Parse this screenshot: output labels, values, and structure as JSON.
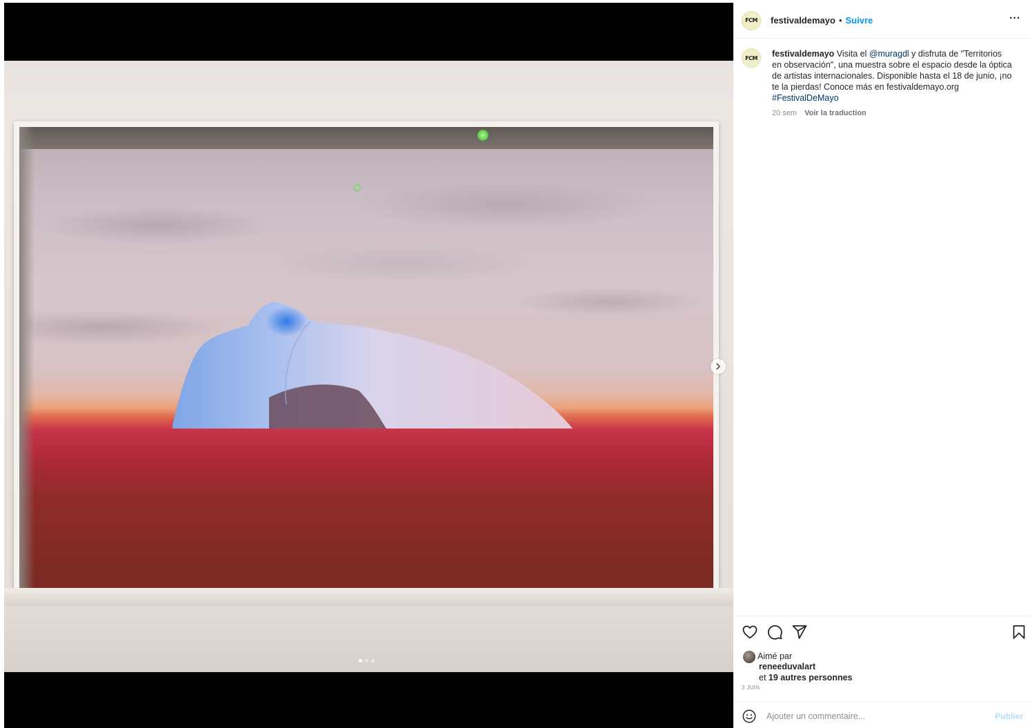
{
  "post": {
    "username": "festivaldemayo",
    "avatar_text": "FCM",
    "follow_label": "Suivre",
    "separator": "•",
    "more_label": "···"
  },
  "caption": {
    "username": "festivaldemayo",
    "text_before_mention": " Visita el ",
    "mention": "@muragdl",
    "text_after_mention": " y disfruta de \"Territorios en observación\", una muestra sobre el espacio desde la óptica de artistas internacionales. Disponible hasta el 18 de junio, ¡no te la pierdas! Conoce más en festivaldemayo.org",
    "hashtag": "#FestivalDeMayo",
    "age": "20 sem",
    "translate_label": "Voir la traduction"
  },
  "carousel": {
    "total": 3,
    "active_index": 0
  },
  "likes": {
    "prefix": "Aimé par",
    "user": "reneeduvalart",
    "others_prefix": "et ",
    "others": "19 autres personnes"
  },
  "date": "3 JUIN",
  "comment": {
    "placeholder": "Ajouter un commentaire...",
    "publish_label": "Publier"
  },
  "icons": {
    "like": "heart-icon",
    "comment": "comment-icon",
    "share": "send-icon",
    "save": "bookmark-icon",
    "emoji": "emoji-icon",
    "next": "chevron-right-icon"
  },
  "colors": {
    "accent": "#0095f6",
    "link": "#00376b",
    "text": "#262626",
    "muted": "#8e8e8e"
  }
}
